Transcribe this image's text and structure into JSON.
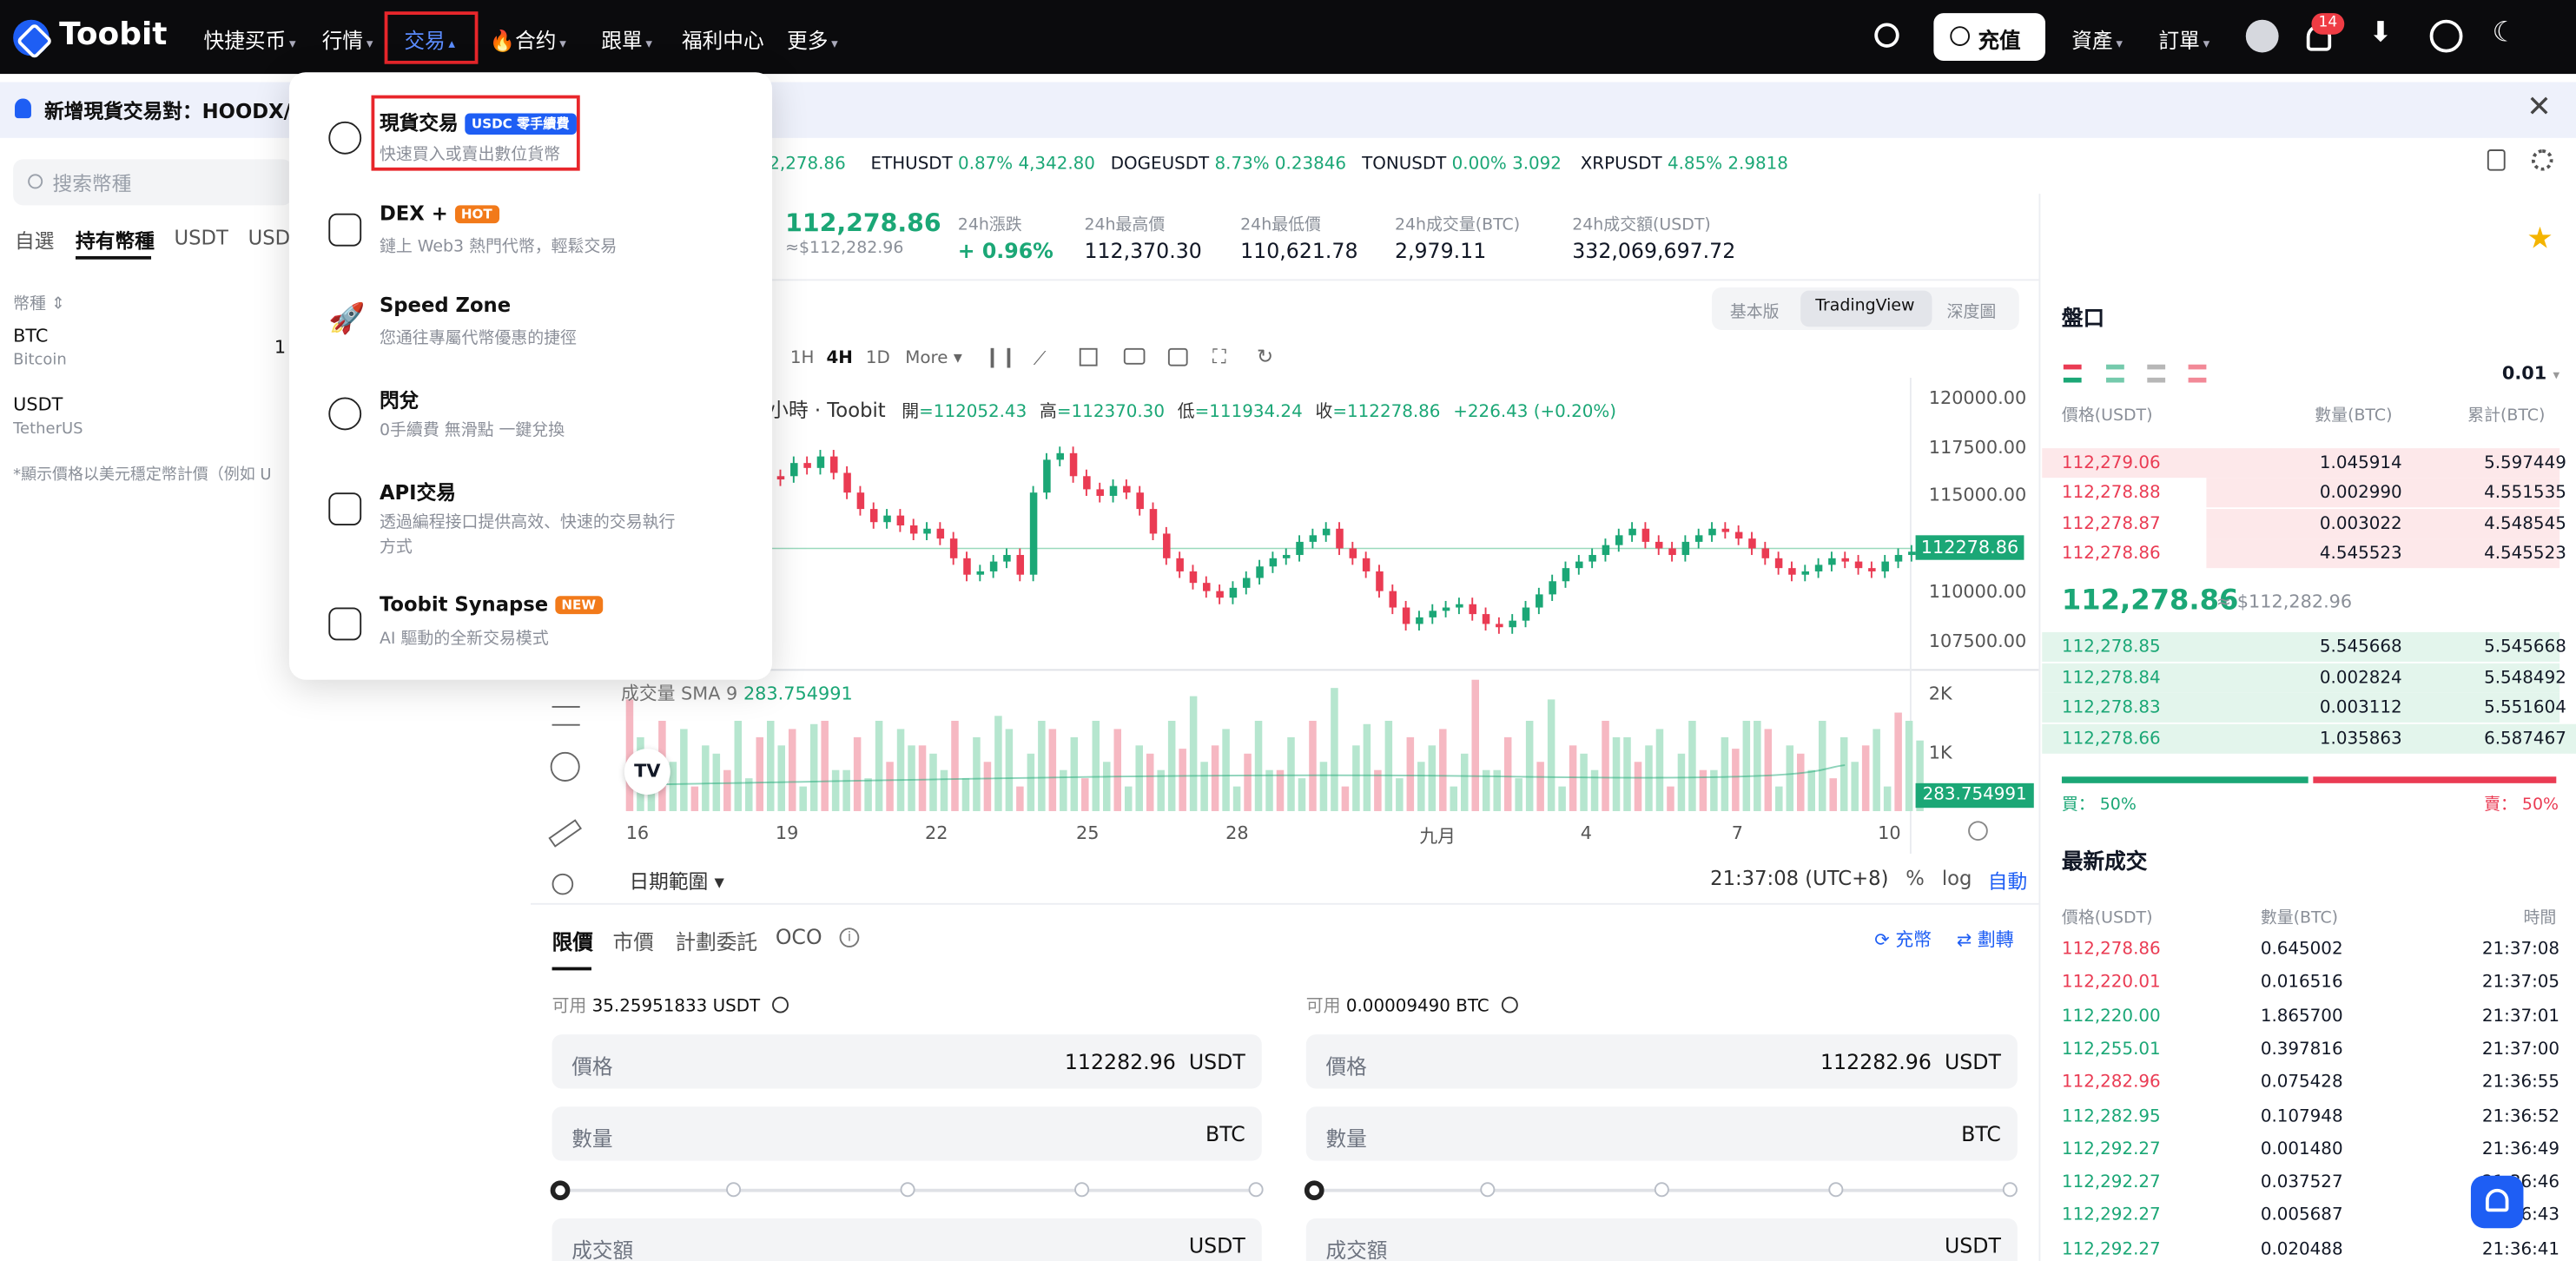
{
  "brand": {
    "name": "Toobit"
  },
  "nav": {
    "items": [
      "快捷买币",
      "行情",
      "交易",
      "合约",
      "跟單",
      "福利中心",
      "更多"
    ]
  },
  "header_right": {
    "deposit": "充值",
    "assets": "資產",
    "orders": "訂單",
    "notif_count": "14"
  },
  "banner": {
    "text": "新增現貨交易對：HOODX/U"
  },
  "sidebar": {
    "search_placeholder": "搜索幣種",
    "tabs": [
      "自選",
      "持有幣種",
      "USDT",
      "USD"
    ],
    "col_header": "幣種",
    "coins": [
      {
        "symbol": "BTC",
        "name": "Bitcoin",
        "price_partial": "1"
      },
      {
        "symbol": "USDT",
        "name": "TetherUS"
      }
    ],
    "note": "*顯示價格以美元穩定幣計價（例如 U"
  },
  "ticker_bar": [
    {
      "pair": "",
      "change": "",
      "price": "2,278.86"
    },
    {
      "pair": "ETHUSDT",
      "change": "0.87%",
      "price": "4,342.80"
    },
    {
      "pair": "DOGEUSDT",
      "change": "8.73%",
      "price": "0.23846"
    },
    {
      "pair": "TONUSDT",
      "change": "0.00%",
      "price": "3.092"
    },
    {
      "pair": "XRPUSDT",
      "change": "4.85%",
      "price": "2.9818"
    }
  ],
  "summary": {
    "last_price": "112,278.86",
    "last_price_usd": "≈$112,282.96",
    "stats": [
      {
        "label": "24h漲跌",
        "value": "+ 0.96%"
      },
      {
        "label": "24h最高價",
        "value": "112,370.30"
      },
      {
        "label": "24h最低價",
        "value": "110,621.78"
      },
      {
        "label": "24h成交量(BTC)",
        "value": "2,979.11"
      },
      {
        "label": "24h成交額(USDT)",
        "value": "332,069,697.72"
      }
    ]
  },
  "chart_tabs": [
    "基本版",
    "TradingView",
    "深度圖"
  ],
  "chart_toolbar": {
    "intervals": [
      "1H",
      "4H",
      "1D"
    ],
    "more": "More"
  },
  "chart_legend": {
    "title_partial": "小時 · Toobit",
    "open_label": "開",
    "open": "=112052.43",
    "high_label": "高",
    "high": "=112370.30",
    "low_label": "低",
    "low": "=111934.24",
    "close_label": "收",
    "close": "=112278.86",
    "change": "+226.43 (+0.20%)"
  },
  "price_axis": [
    "120000.00",
    "117500.00",
    "115000.00",
    "112500.00",
    "110000.00",
    "107500.00"
  ],
  "price_axis_current": "112278.86",
  "volume": {
    "label": "成交量 SMA 9",
    "sma": "283.754991",
    "axis": [
      "2K",
      "1K"
    ],
    "current": "283.754991"
  },
  "time_axis": [
    "16",
    "19",
    "22",
    "25",
    "28",
    "九月",
    "4",
    "7",
    "10"
  ],
  "chart_footer": {
    "date_range": "日期範圍",
    "time": "21:37:08 (UTC+8)",
    "pct": "%",
    "log": "log",
    "auto": "自動"
  },
  "dropdown": {
    "items": [
      {
        "title": "現貨交易",
        "tag": "USDC 零手續費",
        "sub": "快速買入或賣出數位貨幣"
      },
      {
        "title": "DEX +",
        "tag": "HOT",
        "sub": "鏈上 Web3 熱門代幣，輕鬆交易"
      },
      {
        "title": "Speed Zone",
        "tag": "",
        "sub": "您通往專屬代幣優惠的捷徑"
      },
      {
        "title": "閃兌",
        "tag": "",
        "sub": "0手續費 無滑點 一鍵兌換"
      },
      {
        "title": "API交易",
        "tag": "",
        "sub": "透過編程接口提供高效、快速的交易執行",
        "sub2": "方式"
      },
      {
        "title": "Toobit Synapse",
        "tag": "NEW",
        "sub": "AI 驅動的全新交易模式"
      }
    ]
  },
  "order_tabs": [
    "限價",
    "市價",
    "計劃委託",
    "OCO"
  ],
  "order_links": {
    "deposit": "充幣",
    "transfer": "劃轉"
  },
  "buy": {
    "avail_label": "可用",
    "avail": "35.25951833 USDT",
    "price_label": "價格",
    "price": "112282.96",
    "price_unit": "USDT",
    "qty_label": "數量",
    "qty_unit": "BTC",
    "total_label": "成交額",
    "total_unit": "USDT"
  },
  "sell": {
    "avail_label": "可用",
    "avail": "0.00009490 BTC",
    "price_label": "價格",
    "price": "112282.96",
    "price_unit": "USDT",
    "qty_label": "數量",
    "qty_unit": "BTC",
    "total_label": "成交額",
    "total_unit": "USDT"
  },
  "orderbook": {
    "title": "盤口",
    "precision": "0.01",
    "headers": [
      "價格(USDT)",
      "數量(BTC)",
      "累計(BTC)"
    ],
    "asks": [
      [
        "112,279.06",
        "1.045914",
        "5.597449"
      ],
      [
        "112,278.88",
        "0.002990",
        "4.551535"
      ],
      [
        "112,278.87",
        "0.003022",
        "4.548545"
      ],
      [
        "112,278.86",
        "4.545523",
        "4.545523"
      ]
    ],
    "mid": "112,278.86",
    "mid_usd": "≈ $112,282.96",
    "bids": [
      [
        "112,278.85",
        "5.545668",
        "5.545668"
      ],
      [
        "112,278.84",
        "0.002824",
        "5.548492"
      ],
      [
        "112,278.83",
        "0.003112",
        "5.551604"
      ],
      [
        "112,278.66",
        "1.035863",
        "6.587467"
      ]
    ],
    "buy_ratio": "買： 50%",
    "sell_ratio": "賣： 50%"
  },
  "trades": {
    "title": "最新成交",
    "headers": [
      "價格(USDT)",
      "數量(BTC)",
      "時間"
    ],
    "rows": [
      [
        "112,278.86",
        "0.645002",
        "21:37:08",
        "red"
      ],
      [
        "112,220.01",
        "0.016516",
        "21:37:05",
        "red"
      ],
      [
        "112,220.00",
        "1.865700",
        "21:37:01",
        "green"
      ],
      [
        "112,255.01",
        "0.397816",
        "21:37:00",
        "green"
      ],
      [
        "112,282.96",
        "0.075428",
        "21:36:55",
        "red"
      ],
      [
        "112,282.95",
        "0.107948",
        "21:36:52",
        "green"
      ],
      [
        "112,292.27",
        "0.001480",
        "21:36:49",
        "green"
      ],
      [
        "112,292.27",
        "0.037527",
        "21:36:46",
        "green"
      ],
      [
        "112,292.27",
        "0.005687",
        "21:36:43",
        "green"
      ],
      [
        "112,292.27",
        "0.020488",
        "21:36:41",
        "green"
      ]
    ]
  },
  "colors": {
    "up": "#1ba776",
    "down": "#ea3b53",
    "accent": "#1e5ef4"
  }
}
